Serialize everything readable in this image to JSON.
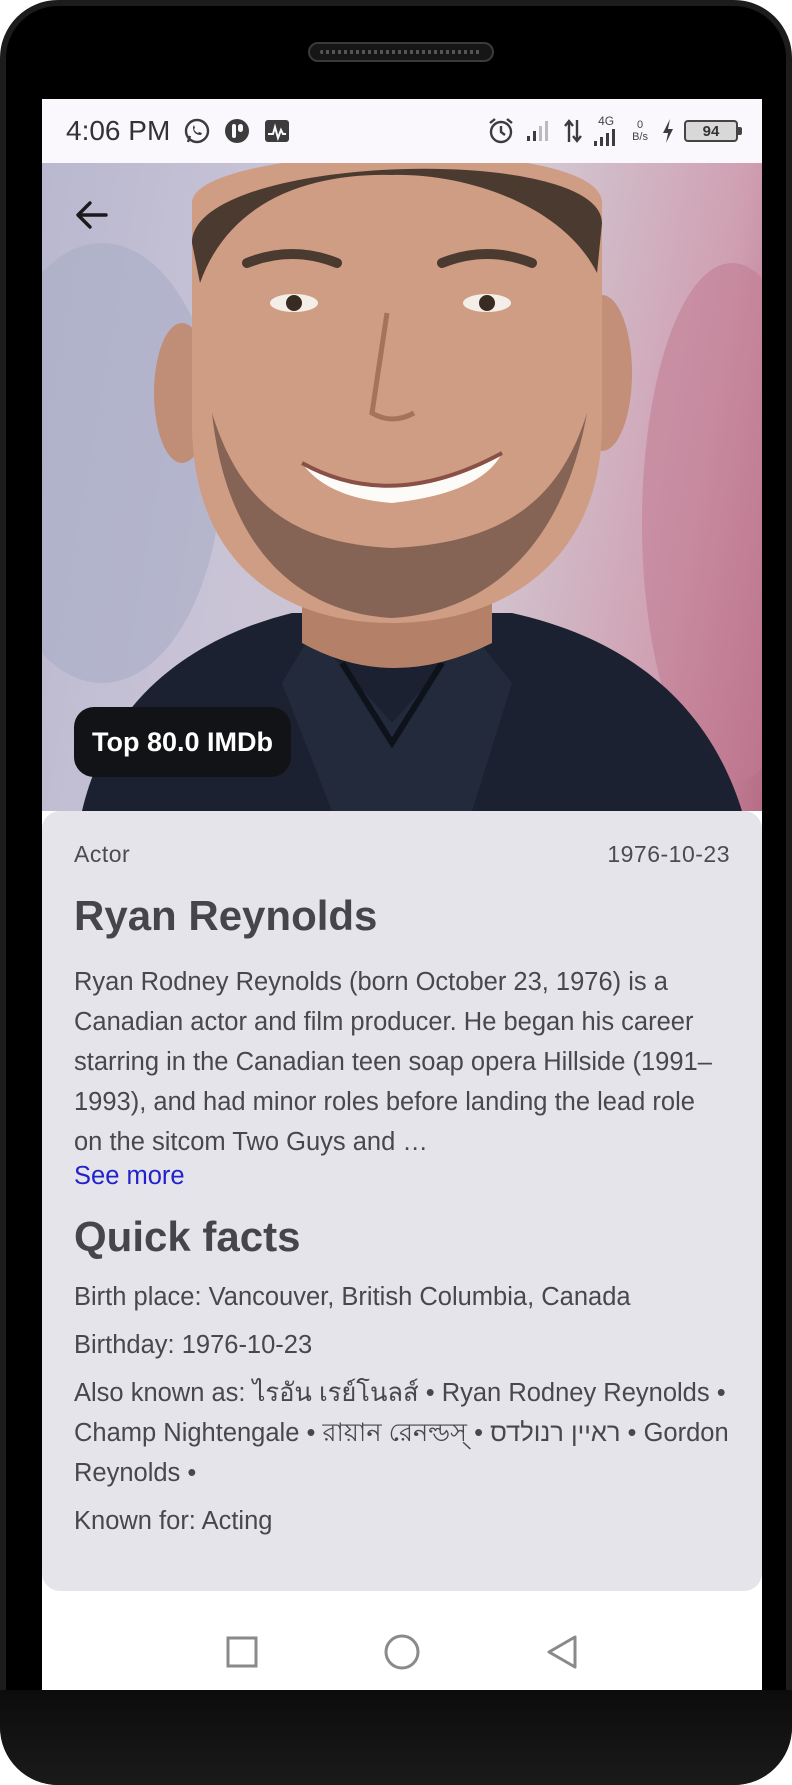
{
  "status_bar": {
    "time": "4:06 PM",
    "left_icons": [
      "whatsapp-icon",
      "podcast-app-icon",
      "activity-app-icon"
    ],
    "right_icons": [
      "alarm-icon",
      "signal-icon",
      "data-arrows-icon",
      "signal-4g-icon",
      "net-speed-icon",
      "charging-icon",
      "battery-icon"
    ],
    "network_type": "4G",
    "net_speed_value": "0",
    "net_speed_unit": "B/s",
    "battery_level": "94"
  },
  "hero": {
    "badge": "Top 80.0 IMDb"
  },
  "person": {
    "role": "Actor",
    "date": "1976-10-23",
    "name": "Ryan Reynolds",
    "bio": "Ryan Rodney Reynolds (born October 23, 1976) is a Canadian actor and film producer. He began his career starring in the Canadian teen soap opera Hillside (1991–1993), and had minor roles before landing the lead role on the sitcom Two Guys and …",
    "see_more": "See more"
  },
  "quick_facts": {
    "title": "Quick facts",
    "birth_place": "Birth place: Vancouver, British Columbia, Canada",
    "birthday": "Birthday: 1976-10-23",
    "also_known_as": "Also known as: ไรอัน เรย์โนลส์ • Ryan Rodney Reynolds • Champ Nightengale • রায়ান রেনল্ডস্ • ראיין רנולדס • Gordon Reynolds •",
    "known_for": "Known for: Acting"
  },
  "nav_bar": {
    "buttons": [
      "recents-square-icon",
      "home-circle-icon",
      "back-triangle-icon"
    ]
  }
}
